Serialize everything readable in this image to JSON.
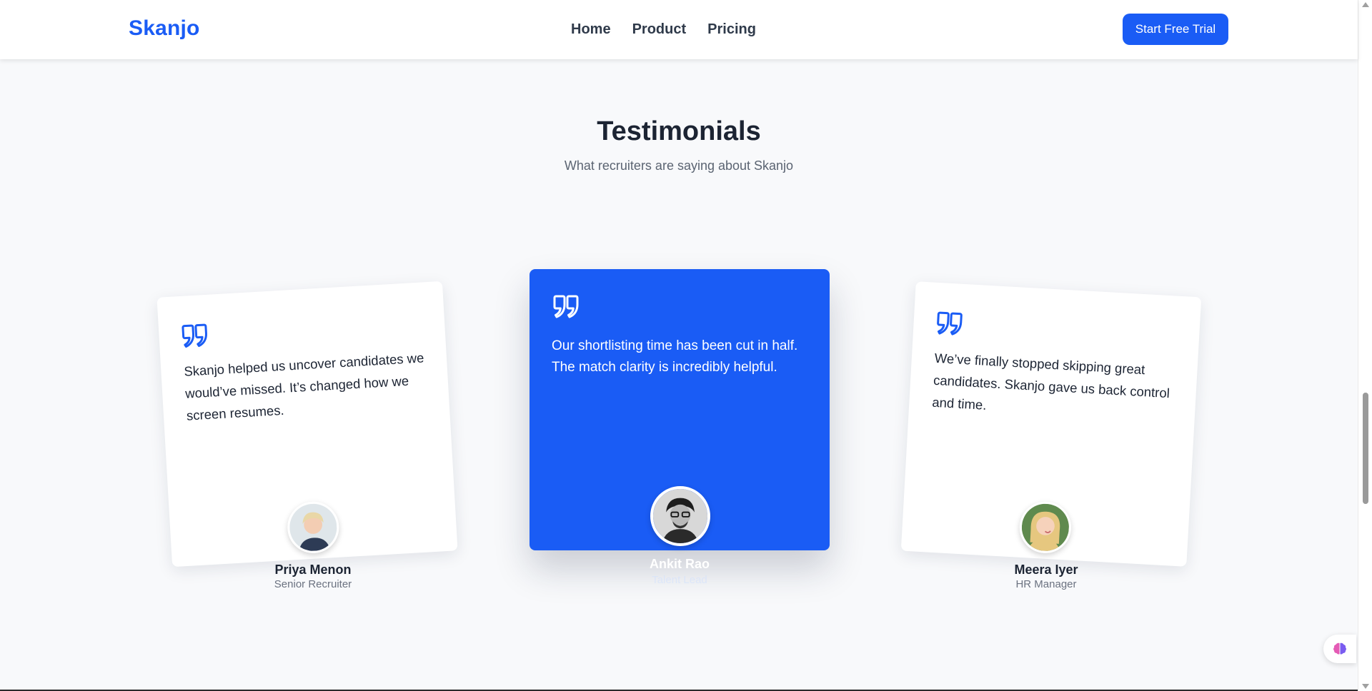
{
  "navbar": {
    "brand": "Skanjo",
    "links": [
      "Home",
      "Product",
      "Pricing"
    ],
    "cta_label": "Start Free Trial"
  },
  "section": {
    "title": "Testimonials",
    "subtitle": "What recruiters are saying about Skanjo"
  },
  "testimonials": [
    {
      "quote": "Skanjo helped us uncover candidates we would’ve missed. It’s changed how we screen resumes.",
      "name": "Priya Menon",
      "role": "Senior Recruiter",
      "avatar_icon": "woman-short-hair-avatar"
    },
    {
      "quote": "Our shortlisting time has been cut in half. The match clarity is incredibly helpful.",
      "name": "Ankit Rao",
      "role": "Talent Lead",
      "avatar_icon": "man-glasses-avatar"
    },
    {
      "quote": "We’ve finally stopped skipping great candidates. Skanjo gave us back control and time.",
      "name": "Meera Iyer",
      "role": "HR Manager",
      "avatar_icon": "woman-blonde-avatar"
    }
  ],
  "colors": {
    "brand_blue": "#1a5cf5",
    "page_bg": "#f8f9fb",
    "text_dark": "#1c2433",
    "text_muted": "#6b7280"
  },
  "widget": {
    "icon": "brain-icon"
  }
}
